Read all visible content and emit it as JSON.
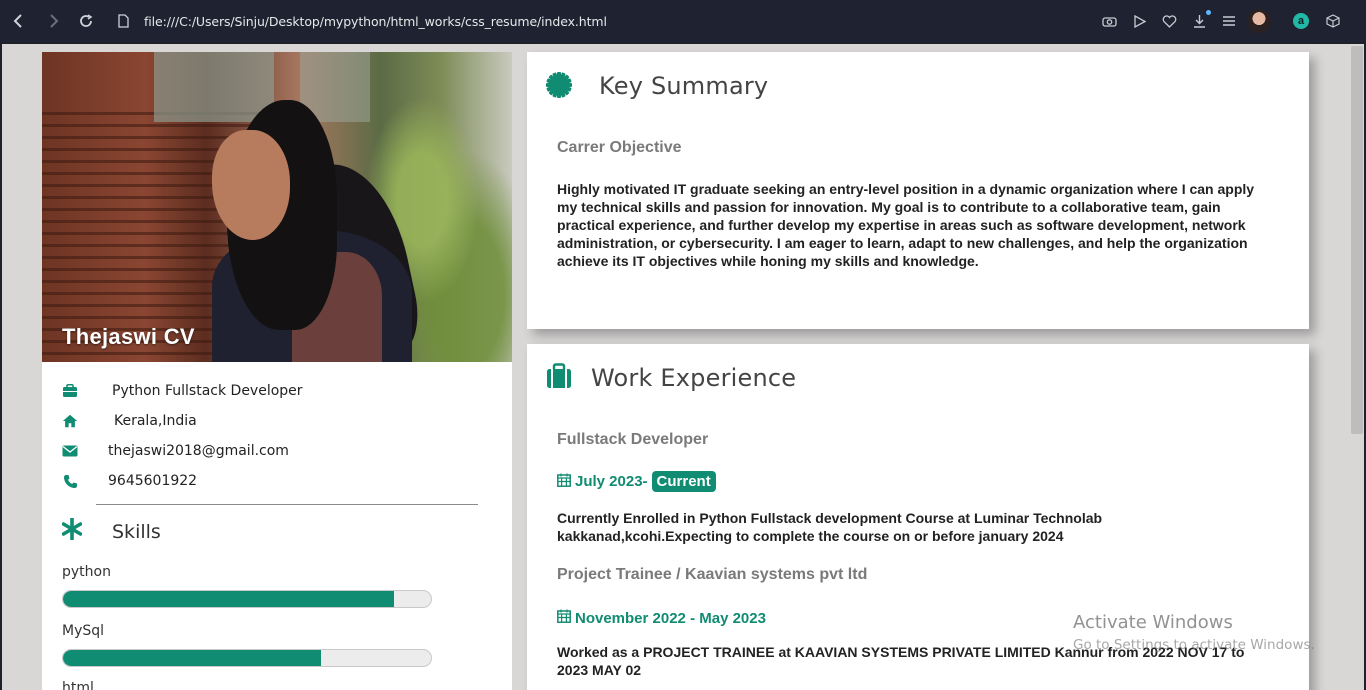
{
  "browser": {
    "url": "file:///C:/Users/Sinju/Desktop/mypython/html_works/css_resume/index.html",
    "extension_letter": "a"
  },
  "profile": {
    "name": "Thejaswi CV",
    "role": "Python Fullstack Developer",
    "location": "Kerala,India",
    "email": "thejaswi2018@gmail.com",
    "phone": "9645601922"
  },
  "skills": {
    "title": "Skills",
    "items": [
      {
        "label": "python",
        "level": 0.9
      },
      {
        "label": "MySql",
        "level": 0.7
      },
      {
        "label": "html",
        "level": 0
      }
    ]
  },
  "summary": {
    "title": "Key Summary",
    "subtitle": "Carrer Objective",
    "text": "Highly motivated IT graduate seeking an entry-level position in a dynamic organization where I can apply my technical skills and passion for innovation. My goal is to contribute to a collaborative team, gain practical experience, and further develop my expertise in areas such as software development, network administration, or cybersecurity. I am eager to learn, adapt to new challenges, and help the organization achieve its IT objectives while honing my skills and knowledge."
  },
  "experience": {
    "title": "Work Experience",
    "jobs": [
      {
        "title": "Fullstack Developer",
        "date": "July 2023-",
        "badge": "Current",
        "desc": "Currently Enrolled in Python Fullstack development Course at Luminar Technolab kakkanad,kcohi.Expecting to complete the course on or before january 2024"
      },
      {
        "title": "Project Trainee / Kaavian systems pvt ltd",
        "date": "November 2022 - May 2023",
        "desc": "Worked as a PROJECT TRAINEE at KAAVIAN SYSTEMS PRIVATE LIMITED Kannur from 2022 NOV 17 to 2023 MAY 02"
      }
    ]
  },
  "os_watermark": {
    "line1": "Activate Windows",
    "line2": "Go to Settings to activate Windows."
  },
  "colors": {
    "accent": "#108c72",
    "page_bg": "#d9d6d6",
    "browser_bar": "#1f2230"
  }
}
